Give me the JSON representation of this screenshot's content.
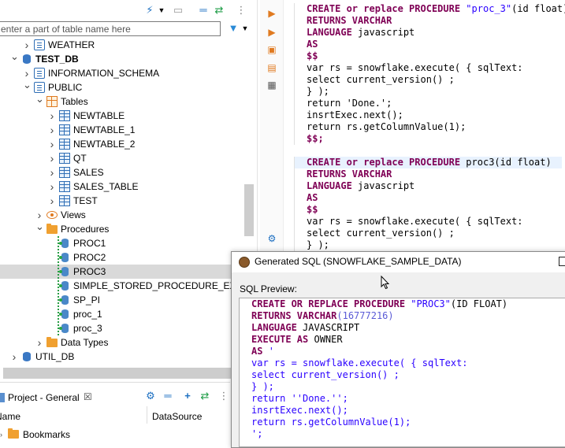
{
  "navigator": {
    "filter_placeholder": "enter a part of table name here",
    "tree": [
      {
        "label": "WEATHER",
        "icon": "schema-icon",
        "twisty": "collapsed",
        "bold": false
      },
      {
        "label": "TEST_DB",
        "icon": "database-icon",
        "twisty": "expanded",
        "bold": true
      },
      {
        "label": "INFORMATION_SCHEMA",
        "icon": "schema-icon",
        "twisty": "collapsed",
        "bold": false
      },
      {
        "label": "PUBLIC",
        "icon": "schema-icon",
        "twisty": "expanded",
        "bold": false
      },
      {
        "label": "Tables",
        "icon": "tables-folder-icon",
        "twisty": "expanded",
        "bold": false
      },
      {
        "label": "NEWTABLE",
        "icon": "table-icon",
        "twisty": "collapsed",
        "bold": false
      },
      {
        "label": "NEWTABLE_1",
        "icon": "table-icon",
        "twisty": "collapsed",
        "bold": false
      },
      {
        "label": "NEWTABLE_2",
        "icon": "table-icon",
        "twisty": "collapsed",
        "bold": false
      },
      {
        "label": "QT",
        "icon": "table-icon",
        "twisty": "collapsed",
        "bold": false
      },
      {
        "label": "SALES",
        "icon": "table-icon",
        "twisty": "collapsed",
        "bold": false
      },
      {
        "label": "SALES_TABLE",
        "icon": "table-icon",
        "twisty": "collapsed",
        "bold": false
      },
      {
        "label": "TEST",
        "icon": "table-icon",
        "twisty": "collapsed",
        "bold": false
      },
      {
        "label": "Views",
        "icon": "views-icon",
        "twisty": "collapsed",
        "bold": false
      },
      {
        "label": "Procedures",
        "icon": "folder-icon",
        "twisty": "expanded",
        "bold": false
      },
      {
        "label": "PROC1",
        "icon": "procedure-icon",
        "twisty": "none",
        "bold": false
      },
      {
        "label": "PROC2",
        "icon": "procedure-icon",
        "twisty": "none",
        "bold": false
      },
      {
        "label": "PROC3",
        "icon": "procedure-icon",
        "twisty": "none",
        "bold": false,
        "selected": true
      },
      {
        "label": "SIMPLE_STORED_PROCEDURE_EXAMP",
        "icon": "procedure-icon",
        "twisty": "none",
        "bold": false
      },
      {
        "label": "SP_PI",
        "icon": "procedure-icon",
        "twisty": "none",
        "bold": false
      },
      {
        "label": "proc_1",
        "icon": "procedure-icon",
        "twisty": "none",
        "bold": false
      },
      {
        "label": "proc_3",
        "icon": "procedure-icon",
        "twisty": "none",
        "bold": false
      },
      {
        "label": "Data Types",
        "icon": "folder-icon",
        "twisty": "collapsed",
        "bold": false
      },
      {
        "label": "UTIL_DB",
        "icon": "database-icon",
        "twisty": "collapsed",
        "bold": false
      }
    ]
  },
  "project": {
    "tab_label": "Project - General",
    "col_name": "Name",
    "col_datasource": "DataSource",
    "bookmarks_label": "Bookmarks"
  },
  "editor": {
    "block1": [
      [
        [
          "kw",
          "CREATE or replace PROCEDURE "
        ],
        [
          "str",
          "\"proc_3\""
        ],
        [
          "txt",
          "(id float)"
        ]
      ],
      [
        [
          "kw",
          "RETURNS VARCHAR"
        ]
      ],
      [
        [
          "kw",
          "LANGUAGE "
        ],
        [
          "txt",
          "javascript"
        ]
      ],
      [
        [
          "kw",
          "AS"
        ]
      ],
      [
        [
          "kw",
          "$$"
        ]
      ],
      [
        [
          "txt",
          "var rs = snowflake.execute( { sqlText:"
        ]
      ],
      [
        [
          "txt",
          "select current_version() ;"
        ]
      ],
      [
        [
          "txt",
          "} );"
        ]
      ],
      [
        [
          "txt",
          "return 'Done.';"
        ]
      ],
      [
        [
          "txt",
          "insrtExec.next();"
        ]
      ],
      [
        [
          "txt",
          "return rs.getColumnValue(1);"
        ]
      ],
      [
        [
          "kw",
          "$$;"
        ]
      ]
    ],
    "block2": [
      [
        [
          "kw",
          "CREATE or replace PROCEDURE "
        ],
        [
          "txt",
          "proc3(id float)"
        ]
      ],
      [
        [
          "kw",
          "RETURNS VARCHAR"
        ]
      ],
      [
        [
          "kw",
          "LANGUAGE "
        ],
        [
          "txt",
          "javascript"
        ]
      ],
      [
        [
          "kw",
          "AS"
        ]
      ],
      [
        [
          "kw",
          "$$"
        ]
      ],
      [
        [
          "txt",
          "var rs = snowflake.execute( { sqlText:"
        ]
      ],
      [
        [
          "txt",
          "select current_version() ;"
        ]
      ],
      [
        [
          "txt",
          "} );"
        ]
      ]
    ]
  },
  "dialog": {
    "title": "Generated SQL (SNOWFLAKE_SAMPLE_DATA)",
    "preview_label": "SQL Preview:",
    "sql": [
      [
        [
          "kw",
          "CREATE OR REPLACE PROCEDURE "
        ],
        [
          "str",
          "\"PROC3\""
        ],
        [
          "txt",
          "(ID FLOAT)"
        ]
      ],
      [
        [
          "kw",
          "RETURNS VARCHAR"
        ],
        [
          "num",
          "(16777216)"
        ]
      ],
      [
        [
          "kw",
          "LANGUAGE "
        ],
        [
          "txt",
          "JAVASCRIPT"
        ]
      ],
      [
        [
          "kw",
          "EXECUTE AS "
        ],
        [
          "txt",
          "OWNER"
        ]
      ],
      [
        [
          "kw",
          "AS "
        ],
        [
          "str",
          "'"
        ]
      ],
      [
        [
          "str",
          "var rs = snowflake.execute( { sqlText:"
        ]
      ],
      [
        [
          "str",
          "select current_version() ;"
        ]
      ],
      [
        [
          "str",
          "} );"
        ]
      ],
      [
        [
          "str",
          "return ''Done.'';"
        ]
      ],
      [
        [
          "str",
          "insrtExec.next();"
        ]
      ],
      [
        [
          "str",
          "return rs.getColumnValue(1);"
        ]
      ],
      [
        [
          "str",
          "';"
        ]
      ]
    ]
  },
  "colors": {
    "keyword": "#7f0055",
    "string": "#2a00ff",
    "selection": "#d9d9d9"
  }
}
